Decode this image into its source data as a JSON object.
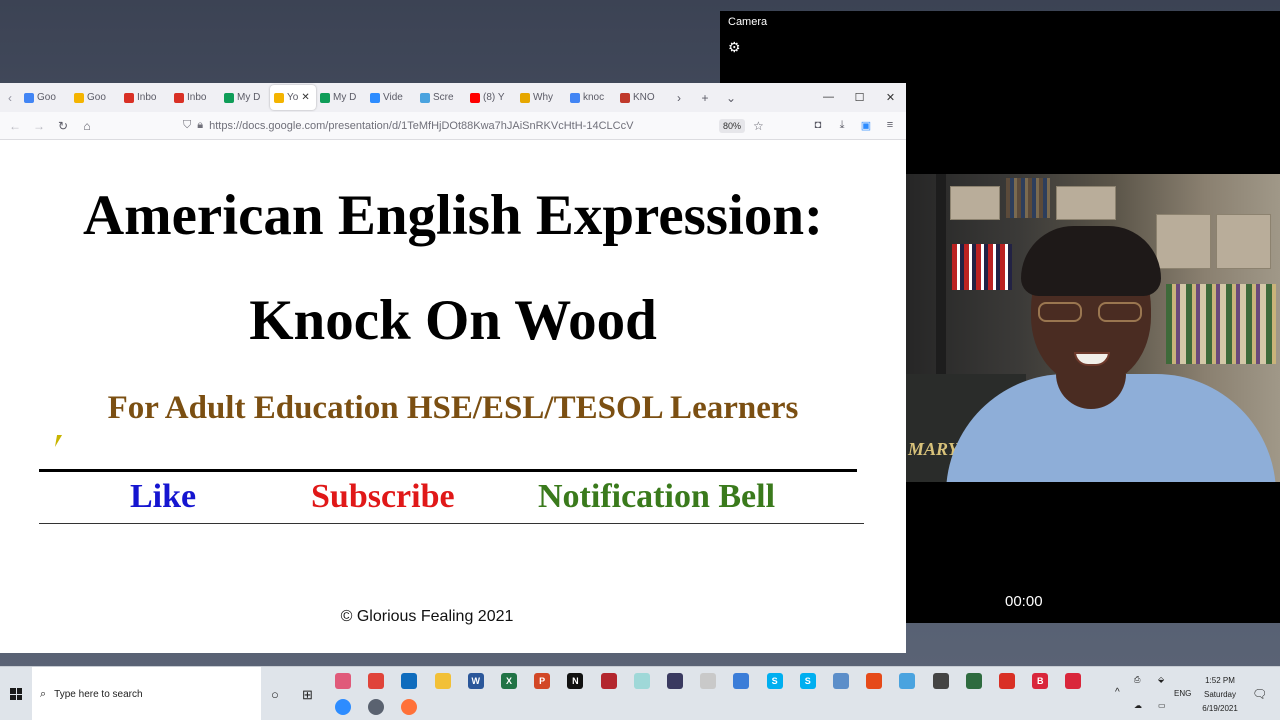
{
  "browser": {
    "tabs": [
      {
        "label": "Goo",
        "icon": "google-calendar-icon",
        "color": "#4285f4"
      },
      {
        "label": "Goo",
        "icon": "google-keep-icon",
        "color": "#f4b400"
      },
      {
        "label": "Inbo",
        "icon": "gmail-icon",
        "color": "#d93025"
      },
      {
        "label": "Inbo",
        "icon": "gmail-icon",
        "color": "#d93025"
      },
      {
        "label": "My D",
        "icon": "google-drive-icon",
        "color": "#0f9d58"
      },
      {
        "label": "Yo",
        "icon": "google-slides-icon",
        "color": "#f4b400",
        "active": true
      },
      {
        "label": "My D",
        "icon": "google-drive-icon",
        "color": "#0f9d58"
      },
      {
        "label": "Vide",
        "icon": "zoom-video-icon",
        "color": "#2d8cff"
      },
      {
        "label": "Scre",
        "icon": "screencast-icon",
        "color": "#4aa3df"
      },
      {
        "label": "(8) Y",
        "icon": "youtube-icon",
        "color": "#ff0000"
      },
      {
        "label": "Why",
        "icon": "h-icon",
        "color": "#e6a700"
      },
      {
        "label": "knoc",
        "icon": "google-icon",
        "color": "#4285f4"
      },
      {
        "label": "KNO",
        "icon": "shield-icon",
        "color": "#c0392b"
      }
    ],
    "url": "https://docs.google.com/presentation/d/1TeMfHjDOt88Kwa7hJAiSnRKVcHtH-14CLCcV",
    "zoom": "80%"
  },
  "slide": {
    "title_line1": "American English Expression:",
    "title_line2": "Knock On Wood",
    "subtitle": "For Adult Education HSE/ESL/TESOL Learners",
    "like": "Like",
    "subscribe": "Subscribe",
    "bell": "Notification Bell",
    "copyright": "© Glorious Fealing 2021",
    "colors": {
      "like": "#1515d0",
      "subscribe": "#e01818",
      "bell": "#3a7a1c",
      "subtitle": "#7b4f12"
    }
  },
  "camera": {
    "title": "Camera",
    "timer": "00:00",
    "wall_text": "MARY."
  },
  "taskbar": {
    "search_placeholder": "Type here to search",
    "apps": [
      {
        "name": "calendar-app-icon",
        "color": "#e05a7a"
      },
      {
        "name": "chrome-icon",
        "color": "#e0443a"
      },
      {
        "name": "outlook-icon",
        "color": "#0f6cbd"
      },
      {
        "name": "file-explorer-icon",
        "color": "#f2c037"
      },
      {
        "name": "word-icon",
        "color": "#2b579a",
        "letter": "W"
      },
      {
        "name": "excel-icon",
        "color": "#217346",
        "letter": "X"
      },
      {
        "name": "powerpoint-icon",
        "color": "#d24726",
        "letter": "P"
      },
      {
        "name": "netflix-icon",
        "color": "#111111",
        "letter": "N"
      },
      {
        "name": "mosaic-app-icon",
        "color": "#b3262e"
      },
      {
        "name": "chat-app-icon",
        "color": "#9fd8d8"
      },
      {
        "name": "screen-recorder-icon",
        "color": "#3a3a60"
      },
      {
        "name": "heart-app-icon",
        "color": "#c9c9c9"
      },
      {
        "name": "globe-icon",
        "color": "#3b7dd8"
      },
      {
        "name": "skype-icon",
        "color": "#00aff0",
        "letter": "S"
      },
      {
        "name": "skype-business-icon",
        "color": "#00aff0",
        "letter": "S"
      },
      {
        "name": "whiteboard-icon",
        "color": "#5c8ec9"
      },
      {
        "name": "office-icon",
        "color": "#e64a19"
      },
      {
        "name": "screencast-icon",
        "color": "#4aa3df"
      },
      {
        "name": "settings-icon",
        "color": "#444444"
      },
      {
        "name": "shield-app-icon",
        "color": "#2e6b3f"
      },
      {
        "name": "pdf-icon",
        "color": "#d93025"
      },
      {
        "name": "b-app-icon",
        "color": "#d9263b",
        "letter": "B"
      },
      {
        "name": "red-shield-icon",
        "color": "#d9263b"
      }
    ],
    "pinned_lower": [
      {
        "name": "zoom-icon",
        "color": "#2d8cff"
      },
      {
        "name": "camera-app-icon",
        "color": "#5a6270"
      },
      {
        "name": "firefox-icon",
        "color": "#ff7139"
      }
    ],
    "language": "ENG",
    "time": "1:52 PM",
    "day": "Saturday",
    "date": "6/19/2021"
  }
}
